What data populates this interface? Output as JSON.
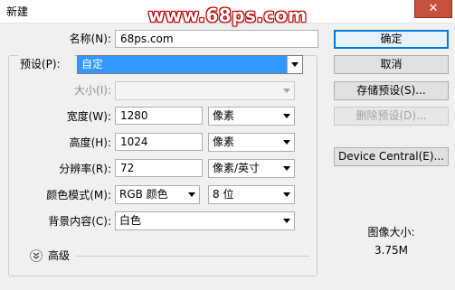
{
  "window": {
    "title": "新建",
    "close_glyph": "✕"
  },
  "watermark": "www.68ps.com",
  "name": {
    "label": "名称(N):",
    "value": "68ps.com"
  },
  "preset": {
    "label": "预设(P):",
    "value": "自定"
  },
  "size": {
    "label": "大小(I):",
    "value": ""
  },
  "width": {
    "label": "宽度(W):",
    "value": "1280",
    "unit": "像素"
  },
  "height": {
    "label": "高度(H):",
    "value": "1024",
    "unit": "像素"
  },
  "resolution": {
    "label": "分辨率(R):",
    "value": "72",
    "unit": "像素/英寸"
  },
  "color_mode": {
    "label": "颜色模式(M):",
    "value": "RGB 颜色",
    "bits": "8 位"
  },
  "background": {
    "label": "背景内容(C):",
    "value": "白色"
  },
  "advanced": {
    "label": "高级",
    "icon": "double-chevron-down-icon"
  },
  "buttons": {
    "ok": "确定",
    "cancel": "取消",
    "save_preset": "存储预设(S)...",
    "delete_preset": "删除预设(D)...",
    "device_central": "Device Central(E)..."
  },
  "image_size": {
    "label": "图像大小:",
    "value": "3.75M"
  },
  "colors": {
    "highlight": "#3399ff",
    "watermark_outline": "#b40000",
    "close": "#c7503f"
  }
}
